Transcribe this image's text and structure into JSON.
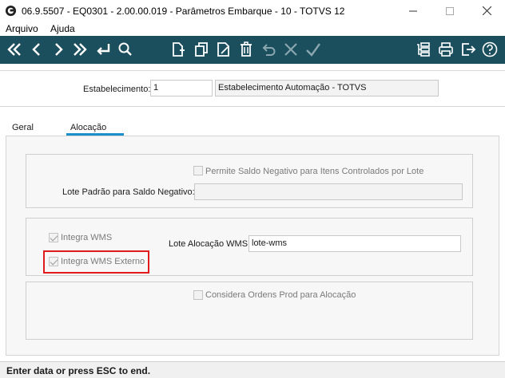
{
  "window": {
    "title": "06.9.5507 - EQ0301 - 2.00.00.019 - Parâmetros Embarque - 10 - TOTVS 12",
    "minimize_glyph": "—",
    "maximize_glyph": "☐",
    "close_glyph": "✕"
  },
  "menu": {
    "items": [
      "Arquivo",
      "Ajuda"
    ]
  },
  "toolbar": {
    "icons": [
      "first-icon",
      "previous-icon",
      "next-icon",
      "last-icon",
      "goto-icon",
      "search-icon",
      "new-icon",
      "copy-icon",
      "edit-icon",
      "delete-icon",
      "undo-icon",
      "cancel-icon",
      "confirm-icon",
      "hierarchy-icon",
      "print-icon",
      "exit-icon",
      "help-icon"
    ],
    "bg_color": "#1b4f5e"
  },
  "header": {
    "estabelecimento_label": "Estabelecimento:",
    "estabelecimento_code": "1",
    "estabelecimento_name": "Estabelecimento Automação - TOTVS"
  },
  "tabs": [
    {
      "label": "Geral",
      "active": false
    },
    {
      "label": "Alocação",
      "active": true
    }
  ],
  "alocacao": {
    "permite_saldo_negativo": {
      "label": "Permite Saldo Negativo para Itens Controlados por Lote",
      "checked": false
    },
    "lote_padrao_label": "Lote Padrão para Saldo Negativo:",
    "lote_padrao_value": "",
    "integra_wms": {
      "label": "Integra WMS",
      "checked": true
    },
    "integra_wms_externo": {
      "label": "Integra WMS Externo",
      "checked": true
    },
    "lote_alocacao_label": "Lote Alocação WMS:",
    "lote_alocacao_value": "lote-wms",
    "considera_ordens": {
      "label": "Considera Ordens Prod para Alocação",
      "checked": false
    }
  },
  "status": {
    "message": "Enter data or press ESC to end."
  },
  "colors": {
    "toolbar": "#1b4f5e",
    "tab_accent": "#1a8fc9",
    "highlight": "#e01b1b"
  }
}
